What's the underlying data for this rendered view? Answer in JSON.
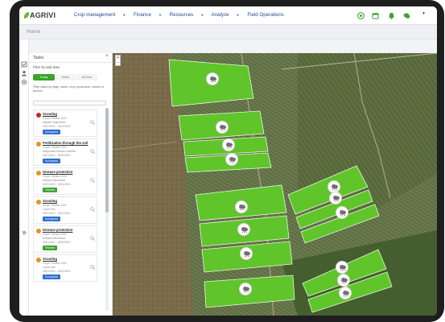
{
  "app": {
    "logo_text": "AGRIVI"
  },
  "nav": {
    "items": [
      {
        "label": "Crop management",
        "has_dropdown": true
      },
      {
        "label": "Finance",
        "has_dropdown": true
      },
      {
        "label": "Resources",
        "has_dropdown": true
      },
      {
        "label": "Analyze",
        "has_dropdown": true
      },
      {
        "label": "Field Operations",
        "has_dropdown": false
      }
    ],
    "icons": [
      "help-icon",
      "calendar-icon",
      "notifications-icon",
      "chat-icon"
    ]
  },
  "breadcrumb": {
    "text": "Home"
  },
  "tasks_panel": {
    "title": "Tasks",
    "filter_by_date": "Filter by task date",
    "chips": [
      {
        "label": "Today",
        "active": true
      },
      {
        "label": "Week",
        "active": false
      },
      {
        "label": "All time",
        "active": false
      }
    ],
    "filter_description": "Filter tasks by tags, name, crop production, status or person",
    "tasks": [
      {
        "title": "Scouting",
        "season": "Crops / Season 2021",
        "person": "Marijela Zaginovska",
        "dates": "03/01/2021 - 03/01/2021",
        "status": "In progress",
        "status_color": "#2f6fd1",
        "icon_color": "#c62828"
      },
      {
        "title": "Fertilization through the soil",
        "season": "Crops / Season 2021",
        "person": "Malgorzata Dziedzic-Kamilka",
        "dates": "03/01/2021 - 03/01/2021",
        "status": "In progress",
        "status_color": "#2f6fd1",
        "icon_color": "#e69419"
      },
      {
        "title": "Disease protection",
        "season": "Crops / Season 2021",
        "person": "Marijela Dabrowska",
        "dates": "03/01/2021 - 03/01/2021",
        "status": "Finished",
        "status_color": "#3ba32e",
        "icon_color": "#e69419"
      },
      {
        "title": "Scouting",
        "season": "Crops / Season 2021",
        "person": "Lucas Vela",
        "dates": "03/01/2021 - 03/01/2021",
        "status": "In progress",
        "status_color": "#2f6fd1",
        "icon_color": "#e69419"
      },
      {
        "title": "Disease protection",
        "season": "Crops / Season 2021",
        "person": "Marijela Dabrowska",
        "dates": "03/01/2021 - 03/01/2021",
        "status": "Finished",
        "status_color": "#3ba32e",
        "icon_color": "#e69419"
      },
      {
        "title": "Scouting",
        "season": "Crops / Season 2021",
        "person": "Lucas Vela",
        "dates": "03/01/2021 - 03/01/2021",
        "status": "In progress",
        "status_color": "#2f6fd1",
        "icon_color": "#e69419"
      }
    ]
  },
  "map": {
    "zoom_in_label": "+",
    "zoom_out_label": "−",
    "field_color": "#5fc52a",
    "field_count": 13,
    "pin_icon": "weather-cloud-icon"
  }
}
